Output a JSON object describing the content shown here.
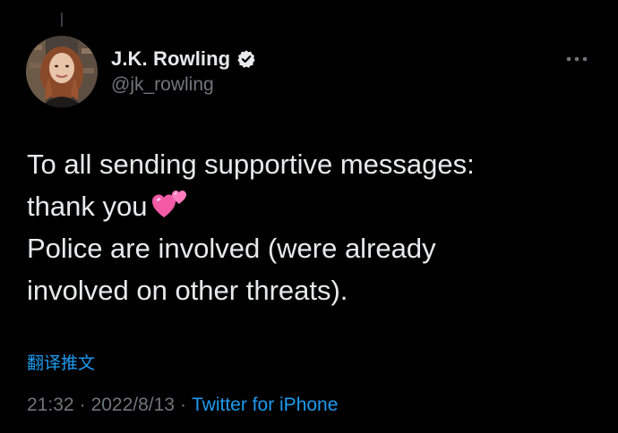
{
  "author": {
    "display_name": "J.K. Rowling",
    "handle": "@jk_rowling",
    "verified": true,
    "avatar_icon": "profile-photo",
    "verified_icon": "verified-badge-icon"
  },
  "menu": {
    "icon": "more-options-icon"
  },
  "tweet": {
    "line_1": "To all sending supportive messages:",
    "line_2": "thank you",
    "line_2_emoji": "two-hearts-emoji",
    "line_3": "Police are involved (were already",
    "line_4": "involved on other threats)."
  },
  "translate_label": "翻译推文",
  "meta": {
    "time": "21:32",
    "date": "2022/8/13",
    "source": "Twitter for iPhone",
    "separator": "·"
  },
  "colors": {
    "background": "#000000",
    "text": "#e7e9ea",
    "secondary": "#71767b",
    "link": "#1d9bf0",
    "emoji_pink": "#f25aa6"
  }
}
